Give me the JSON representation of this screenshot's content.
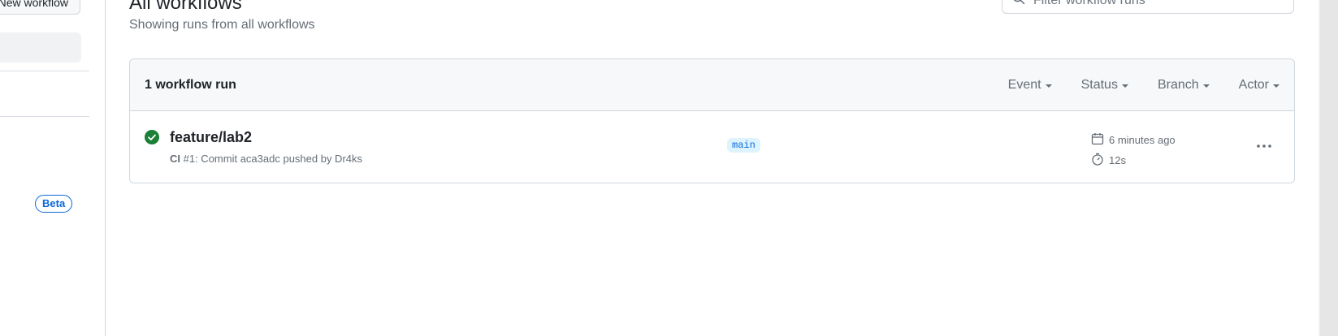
{
  "sidebar": {
    "new_workflow_label": "New workflow",
    "beta_label": "Beta"
  },
  "header": {
    "title": "All workflows",
    "subtitle": "Showing runs from all workflows",
    "filter_placeholder": "Filter workflow runs"
  },
  "runs_panel": {
    "count_label": "1 workflow run",
    "filters": [
      {
        "label": "Event"
      },
      {
        "label": "Status"
      },
      {
        "label": "Branch"
      },
      {
        "label": "Actor"
      }
    ],
    "runs": [
      {
        "title": "feature/lab2",
        "workflow": "CI",
        "meta": "#1: Commit aca3adc pushed by Dr4ks",
        "branch": "main",
        "time_ago": "6 minutes ago",
        "duration": "12s",
        "status": "success"
      }
    ]
  },
  "colors": {
    "success": "#1a7f37",
    "accent": "#0969da",
    "border": "#d0d7de",
    "muted": "#656d76"
  }
}
